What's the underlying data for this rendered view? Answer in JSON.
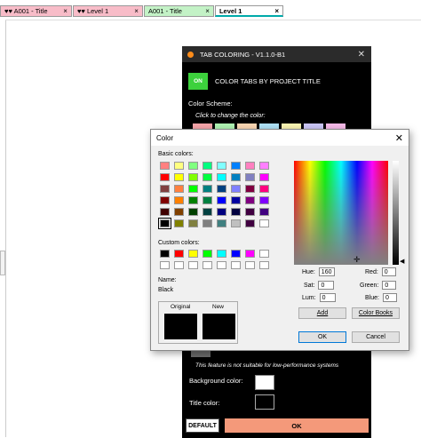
{
  "tabs": [
    {
      "label": "♥♥ A001 - Title",
      "style": "pink",
      "active": false
    },
    {
      "label": "♥♥ Level 1",
      "style": "pink",
      "active": false
    },
    {
      "label": "A001 - Title",
      "style": "green",
      "active": false
    },
    {
      "label": "Level 1",
      "style": "green",
      "active": true
    }
  ],
  "tab_close_glyph": "×",
  "tab_coloring": {
    "title": "TAB COLORING - V1.1.0-B1",
    "toggle_label": "ON",
    "toggle_text": "COLOR TABS BY PROJECT TITLE",
    "scheme_label": "Color Scheme:",
    "scheme_hint": "Click to change the color:",
    "scheme_colors": [
      "#f4a3a8",
      "#aef0b0",
      "#f8d5b0",
      "#aee0f4",
      "#f8f2b0",
      "#c9c4f4",
      "#f4b8e6"
    ],
    "performance_note": "This feature is not suitable for low-performance systems",
    "background_color_label": "Background color:",
    "background_color": "#ffffff",
    "title_color_label": "Title color:",
    "title_color": "#000000",
    "default_button": "DEFAULT",
    "ok_button": "OK"
  },
  "color_dialog": {
    "title": "Color",
    "basic_colors_label": "Basic colors:",
    "basic_colors": [
      "#ff8080",
      "#ffff80",
      "#80ff80",
      "#00ff80",
      "#80ffff",
      "#0080ff",
      "#ff80c0",
      "#ff80ff",
      "#ff0000",
      "#ffff00",
      "#80ff00",
      "#00ff40",
      "#00ffff",
      "#0080c0",
      "#8080c0",
      "#ff00ff",
      "#804040",
      "#ff8040",
      "#00ff00",
      "#008080",
      "#004080",
      "#8080ff",
      "#800040",
      "#ff0080",
      "#800000",
      "#ff8000",
      "#008000",
      "#008040",
      "#0000ff",
      "#0000a0",
      "#800080",
      "#8000ff",
      "#400000",
      "#804000",
      "#004000",
      "#004040",
      "#000080",
      "#000040",
      "#400040",
      "#400080",
      "#000000",
      "#808000",
      "#808040",
      "#808080",
      "#408080",
      "#c0c0c0",
      "#400040",
      "#ffffff"
    ],
    "selected_basic_index": 40,
    "custom_colors_label": "Custom colors:",
    "custom_colors": [
      "#000000",
      "#ff0000",
      "#ffff00",
      "#00ff00",
      "#00ffff",
      "#0000ff",
      "#ff00ff",
      "#ffffff",
      "#ffffff",
      "#ffffff",
      "#ffffff",
      "#ffffff",
      "#ffffff",
      "#ffffff",
      "#ffffff",
      "#ffffff"
    ],
    "name_label": "Name:",
    "name_value": "Black",
    "original_label": "Original",
    "new_label": "New",
    "hue_label": "Hue:",
    "hue": "160",
    "sat_label": "Sat:",
    "sat": "0",
    "lum_label": "Lum:",
    "lum": "0",
    "red_label": "Red:",
    "red": "0",
    "green_label": "Green:",
    "green": "0",
    "blue_label": "Blue:",
    "blue": "0",
    "add_button": "Add",
    "color_books_button": "Color Books",
    "ok_button": "OK",
    "cancel_button": "Cancel"
  }
}
